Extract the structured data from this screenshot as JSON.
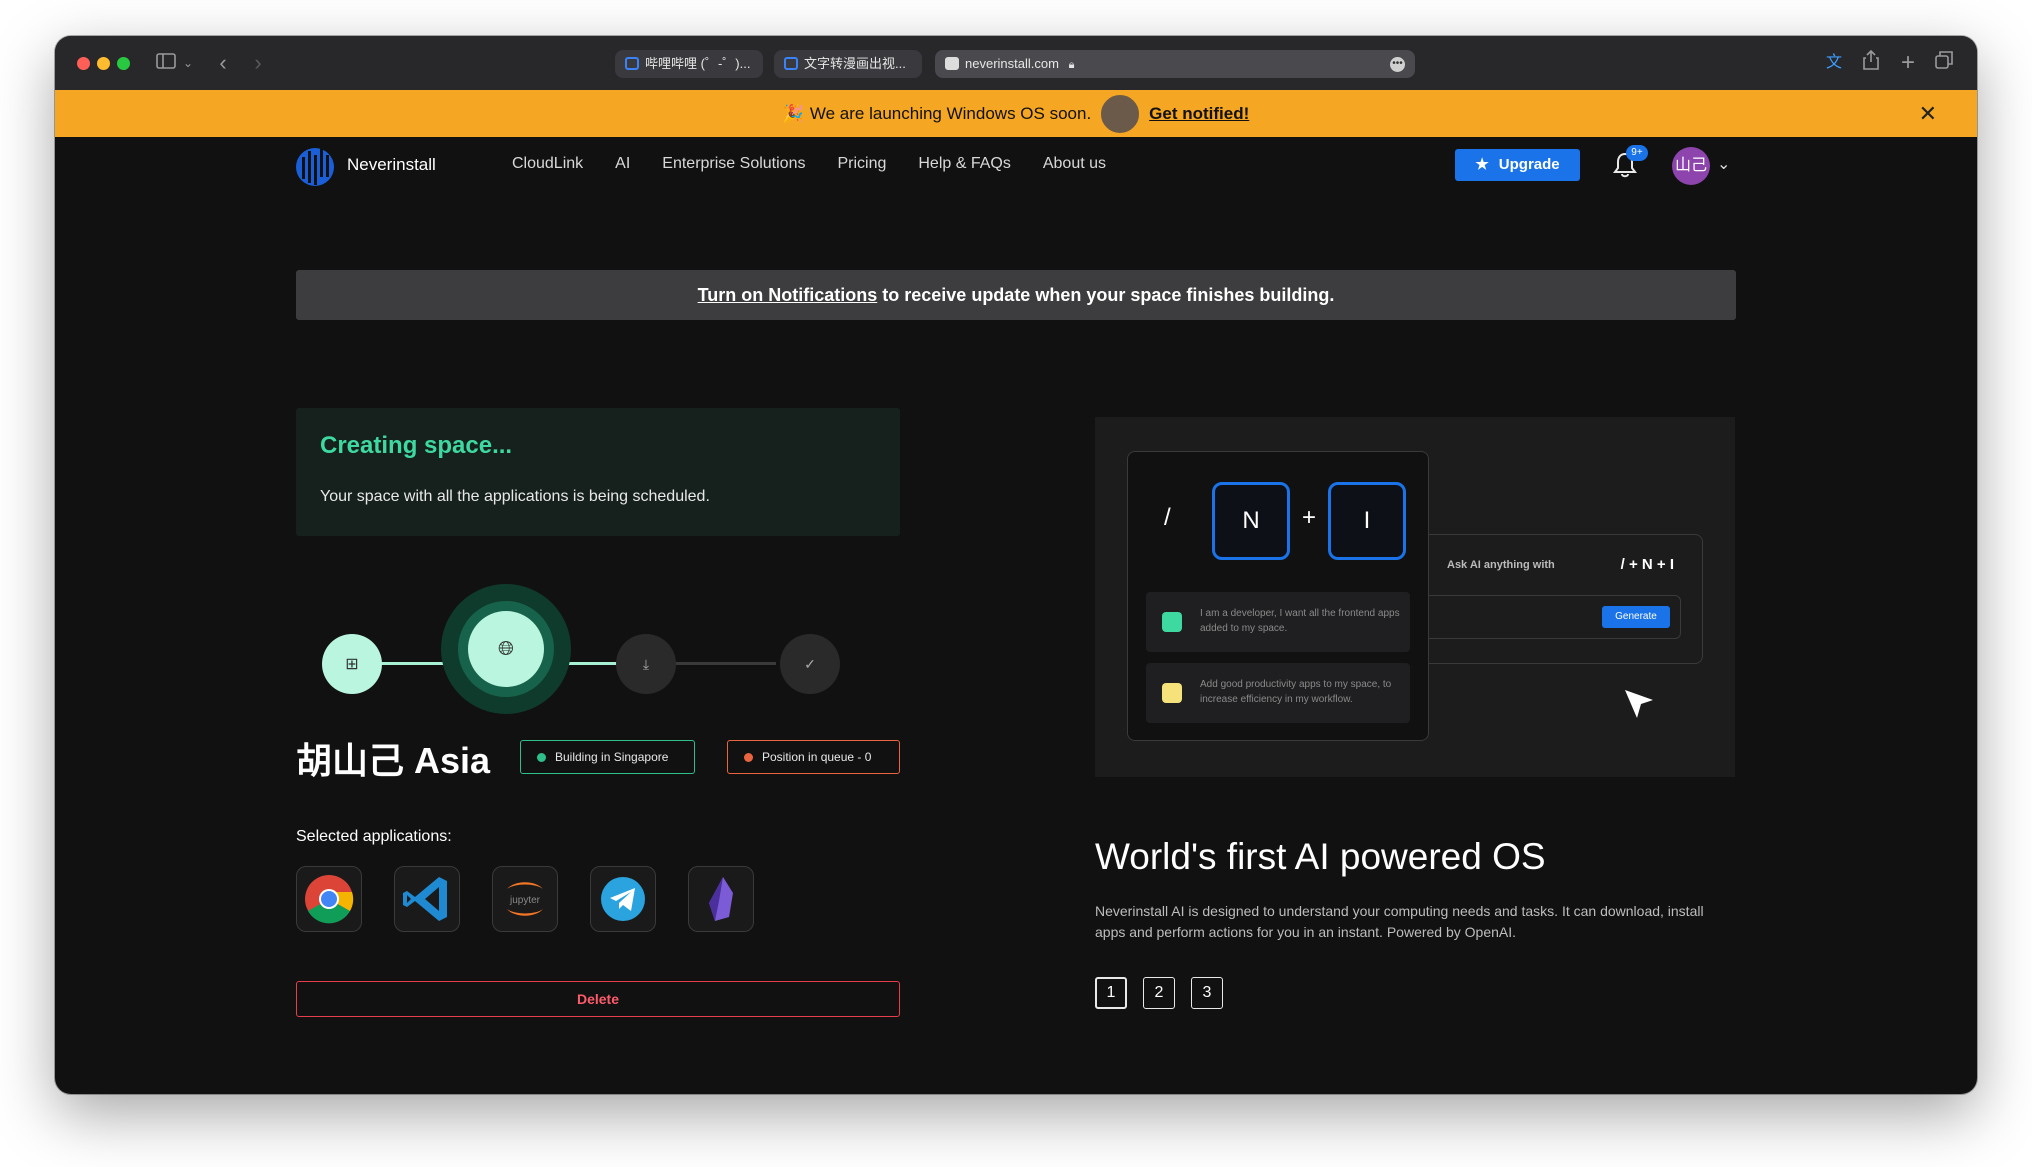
{
  "browser": {
    "tabs": [
      {
        "label": "哔哩哔哩 (゜-゜)..."
      },
      {
        "label": "文字转漫画出视..."
      },
      {
        "label": "neverinstall.com"
      }
    ]
  },
  "banner": {
    "text": "We are launching Windows OS soon.",
    "link": "Get notified!",
    "close": "✕"
  },
  "nav": {
    "brand": "Neverinstall",
    "menu": [
      "CloudLink",
      "AI",
      "Enterprise Solutions",
      "Pricing",
      "Help & FAQs",
      "About us"
    ],
    "upgrade": "Upgrade",
    "notifications_badge": "9+",
    "avatar_initials": "山己"
  },
  "notification_bar": {
    "link": "Turn on Notifications",
    "text": " to receive update when your space finishes building."
  },
  "status": {
    "title": "Creating space...",
    "subtitle": "Your space with all the applications is being scheduled."
  },
  "space": {
    "name": "胡山己 Asia",
    "building": "Building in Singapore",
    "queue": "Position in queue - 0"
  },
  "applications": {
    "label": "Selected applications:",
    "apps": [
      "chrome-icon",
      "vscode-icon",
      "jupyter-icon",
      "telegram-icon",
      "obsidian-icon"
    ],
    "jupyter_text": "jupyter"
  },
  "delete_label": "Delete",
  "demo": {
    "slash": "/",
    "key_n": "N",
    "plus": "+",
    "key_i": "I",
    "suggestion_1": "I am a developer, I want all the frontend apps added to my space.",
    "suggestion_2": "Add good productivity apps to my space, to increase efficiency in my workflow.",
    "ask_label": "Ask AI anything with",
    "ask_keys": "/ + N + I",
    "generate": "Generate"
  },
  "feature": {
    "headline": "World's first AI powered OS",
    "description": "Neverinstall AI is designed to understand your computing needs and tasks. It can download, install apps and perform actions for you in an instant. Powered by OpenAI.",
    "pages": [
      "1",
      "2",
      "3"
    ]
  },
  "colors": {
    "accent": "#1a73e8",
    "banner": "#f5a623",
    "green": "#3dd9a0",
    "danger": "#e53e4a"
  }
}
